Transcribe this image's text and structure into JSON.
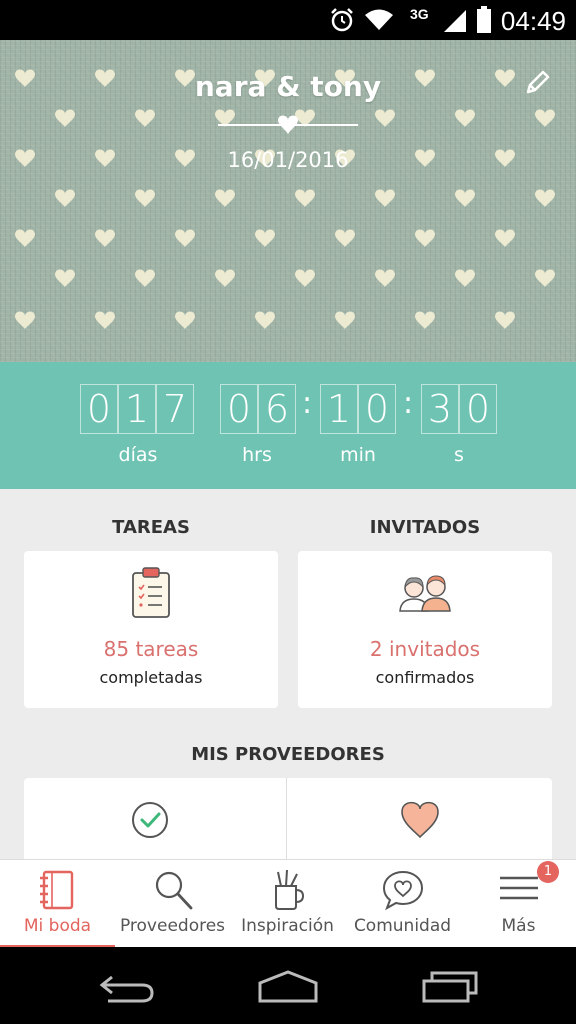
{
  "status_bar": {
    "network": "3G",
    "time": "04:49"
  },
  "hero": {
    "couple_names": "nara & tony",
    "wedding_date": "16/01/2016"
  },
  "countdown": {
    "days": [
      "0",
      "1",
      "7"
    ],
    "hours": [
      "0",
      "6"
    ],
    "minutes": [
      "1",
      "0"
    ],
    "seconds": [
      "3",
      "0"
    ],
    "separator": ":",
    "labels": {
      "days": "días",
      "hours": "hrs",
      "minutes": "min",
      "seconds": "s"
    }
  },
  "tasks": {
    "title": "TAREAS",
    "count_text": "85 tareas",
    "caption": "completadas"
  },
  "guests": {
    "title": "INVITADOS",
    "count_text": "2 invitados",
    "caption": "confirmados"
  },
  "vendors": {
    "title": "MIS PROVEEDORES"
  },
  "bottom_nav": {
    "items": [
      {
        "label": "Mi boda",
        "icon": "notebook-icon",
        "active": true
      },
      {
        "label": "Proveedores",
        "icon": "search-icon",
        "active": false
      },
      {
        "label": "Inspiración",
        "icon": "brush-cup-icon",
        "active": false
      },
      {
        "label": "Comunidad",
        "icon": "chat-heart-icon",
        "active": false
      },
      {
        "label": "Más",
        "icon": "menu-icon",
        "active": false
      }
    ],
    "badge": "1"
  },
  "colors": {
    "teal": "#6fc3b2",
    "coral": "#e4645e",
    "hero_green": "#9fb3a6",
    "heart_cream": "#f3efd6"
  }
}
